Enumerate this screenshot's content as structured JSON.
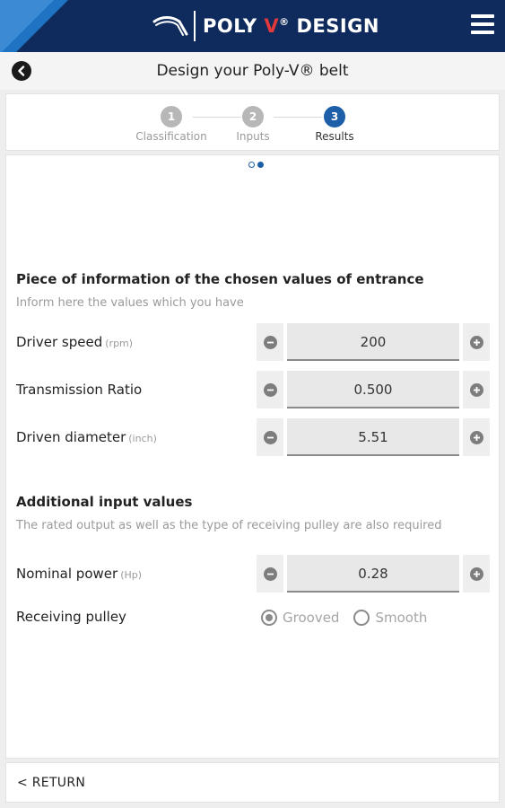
{
  "header": {
    "brand_prefix": "POLY ",
    "brand_v": "V",
    "brand_reg": "®",
    "brand_suffix": " DESIGN",
    "menu_icon": "hamburger-menu-icon",
    "colors": {
      "bar": "#0f2a5c",
      "accent": "#1e74c2",
      "brand_red": "#e23a3a"
    }
  },
  "titlebar": {
    "back_icon": "chevron-left-circle-icon",
    "title": "Design your Poly-V® belt"
  },
  "steps": [
    {
      "number": "1",
      "label": "Classification",
      "active": false
    },
    {
      "number": "2",
      "label": "Inputs",
      "active": false
    },
    {
      "number": "3",
      "label": "Results",
      "active": true
    }
  ],
  "pager": {
    "current_page": 2,
    "total_pages": 2
  },
  "section_entrance": {
    "title": "Piece of information of the chosen values of entrance",
    "subtitle": "Inform here the values which you have",
    "fields": [
      {
        "label": "Driver speed",
        "unit": "(rpm)",
        "value": "200"
      },
      {
        "label": "Transmission Ratio",
        "unit": "",
        "value": "0.500"
      },
      {
        "label": "Driven diameter",
        "unit": "(inch)",
        "value": "5.51"
      }
    ]
  },
  "section_additional": {
    "title": "Additional input values",
    "subtitle": "The rated output as well as the type of receiving pulley are also required",
    "power": {
      "label": "Nominal power",
      "unit": "(Hp)",
      "value": "0.28"
    },
    "pulley": {
      "label": "Receiving pulley",
      "options": [
        "Grooved",
        "Smooth"
      ],
      "selected": "Grooved"
    }
  },
  "footer": {
    "return_label": "< RETURN"
  }
}
